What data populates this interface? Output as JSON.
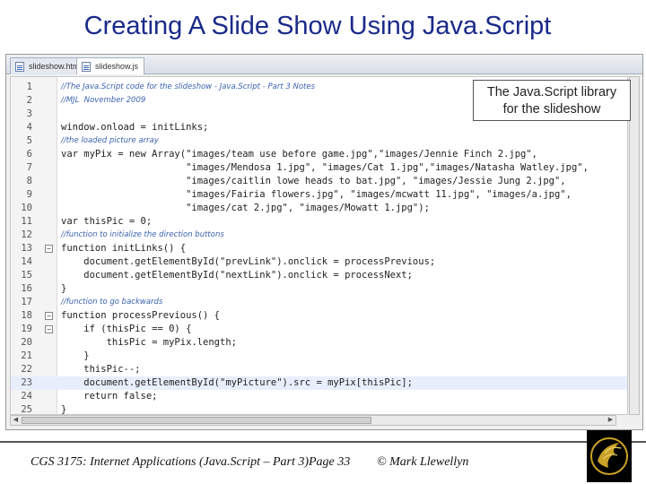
{
  "slide": {
    "title": "Creating A Slide Show Using Java.Script"
  },
  "editor": {
    "tabs": [
      {
        "label": "slideshow.html",
        "active": false
      },
      {
        "label": "slideshow.js",
        "active": true
      }
    ],
    "lines": [
      {
        "n": "1",
        "text": "//The Java.Script code for the slideshow - Java.Script - Part 3 Notes",
        "style": "cmt"
      },
      {
        "n": "2",
        "text": "//MJL  November 2009",
        "style": "cmt"
      },
      {
        "n": "3",
        "text": "",
        "style": ""
      },
      {
        "n": "4",
        "text": "window.onload = initLinks;",
        "style": ""
      },
      {
        "n": "5",
        "text": "//the loaded picture array",
        "style": "cmt"
      },
      {
        "n": "6",
        "text": "var myPix = new Array(\"images/team use before game.jpg\",\"images/Jennie Finch 2.jpg\",",
        "style": ""
      },
      {
        "n": "7",
        "text": "                      \"images/Mendosa 1.jpg\", \"images/Cat 1.jpg\",\"images/Natasha Watley.jpg\",",
        "style": ""
      },
      {
        "n": "8",
        "text": "                      \"images/caitlin lowe heads to bat.jpg\", \"images/Jessie Jung 2.jpg\",",
        "style": ""
      },
      {
        "n": "9",
        "text": "                      \"images/Fairia flowers.jpg\", \"images/mcwatt 11.jpg\", \"images/a.jpg\",",
        "style": ""
      },
      {
        "n": "10",
        "text": "                      \"images/cat 2.jpg\", \"images/Mowatt 1.jpg\");",
        "style": ""
      },
      {
        "n": "11",
        "text": "var thisPic = 0;",
        "style": ""
      },
      {
        "n": "12",
        "text": "//function to initialize the direction buttons",
        "style": "cmt"
      },
      {
        "n": "13",
        "text": "function initLinks() {",
        "style": "",
        "fold": true
      },
      {
        "n": "14",
        "text": "    document.getElementById(\"prevLink\").onclick = processPrevious;",
        "style": ""
      },
      {
        "n": "15",
        "text": "    document.getElementById(\"nextLink\").onclick = processNext;",
        "style": ""
      },
      {
        "n": "16",
        "text": "}",
        "style": ""
      },
      {
        "n": "17",
        "text": "//function to go backwards",
        "style": "cmt"
      },
      {
        "n": "18",
        "text": "function processPrevious() {",
        "style": "",
        "fold": true
      },
      {
        "n": "19",
        "text": "    if (thisPic == 0) {",
        "style": "",
        "fold": true
      },
      {
        "n": "20",
        "text": "        thisPic = myPix.length;",
        "style": ""
      },
      {
        "n": "21",
        "text": "    }",
        "style": ""
      },
      {
        "n": "22",
        "text": "    thisPic--;",
        "style": ""
      },
      {
        "n": "23",
        "text": "    document.getElementById(\"myPicture\").src = myPix[thisPic];",
        "style": "",
        "highlight": true
      },
      {
        "n": "24",
        "text": "    return false;",
        "style": ""
      },
      {
        "n": "25",
        "text": "}",
        "style": ""
      }
    ]
  },
  "callout": {
    "line1": "The Java.Script library",
    "line2": "for the slideshow"
  },
  "footer": {
    "course": "CGS 3175: Internet Applications (Java.Script – Part 3)",
    "page": "Page 33",
    "author": "© Mark Llewellyn"
  },
  "colors": {
    "title": "#1a2a8a",
    "comment": "#3b62b0",
    "highlight_line": "#e8eefc",
    "logo_gold": "#c9a227"
  },
  "icons": {
    "file_tab": "file-icon",
    "logo": "pegasus-logo"
  }
}
